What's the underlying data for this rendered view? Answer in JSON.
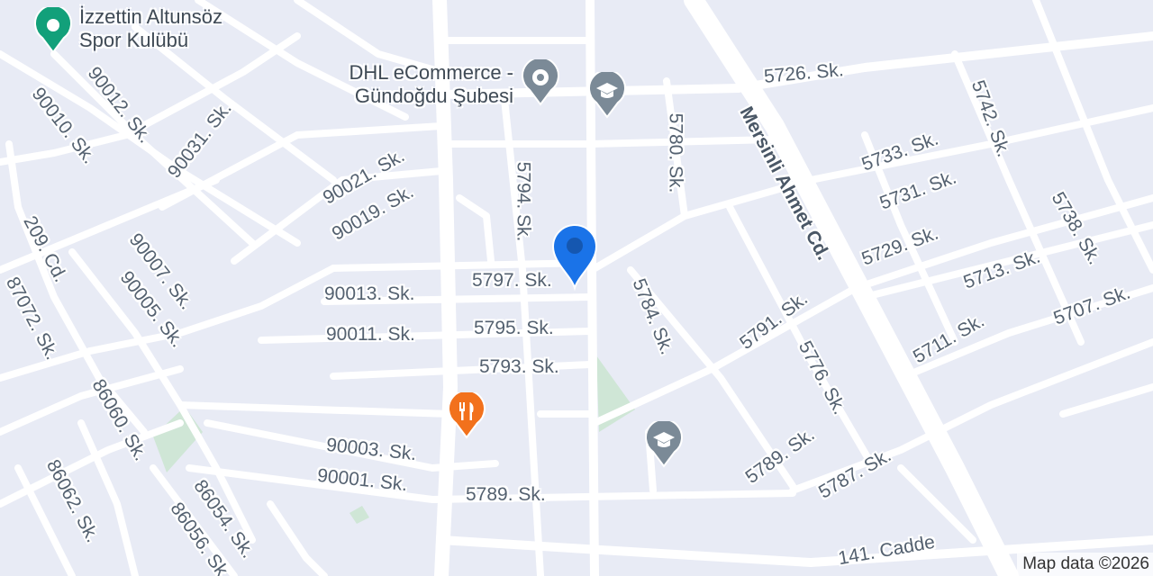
{
  "map": {
    "attribution": "Map data ©2026",
    "colors": {
      "background": "#e8ebf5",
      "road": "#ffffff",
      "park": "#cfe6d6",
      "pin": "#1a73e8",
      "poi_gray": "#7b8a97",
      "poi_orange": "#f2711c",
      "poi_green": "#12a07a"
    }
  },
  "pois": {
    "sport_club": {
      "line1": "İzzettin Altunsöz",
      "line2": "Spor Kulübü",
      "icon": "sport-place-icon"
    },
    "dhl": {
      "line1": "DHL eCommerce -",
      "line2": "Gündoğdu Şubesi",
      "icon": "place-icon"
    },
    "school_north": {
      "icon": "school-icon"
    },
    "school_south": {
      "icon": "school-icon"
    },
    "restaurant": {
      "icon": "restaurant-icon"
    },
    "location": {
      "icon": "location-pin-icon"
    }
  },
  "streets": [
    {
      "id": "s1",
      "text": "90012. Sk."
    },
    {
      "id": "s2",
      "text": "90010. Sk."
    },
    {
      "id": "s3",
      "text": "90031. Sk."
    },
    {
      "id": "s4",
      "text": "90021. Sk."
    },
    {
      "id": "s5",
      "text": "90019. Sk."
    },
    {
      "id": "s6",
      "text": "5794. Sk."
    },
    {
      "id": "s7",
      "text": "5780. Sk."
    },
    {
      "id": "s8",
      "text": "5726. Sk."
    },
    {
      "id": "s9",
      "text": "Mersinli Ahmet Cd."
    },
    {
      "id": "s10",
      "text": "5742. Sk."
    },
    {
      "id": "s11",
      "text": "5733. Sk."
    },
    {
      "id": "s12",
      "text": "5731. Sk."
    },
    {
      "id": "s13",
      "text": "5729. Sk."
    },
    {
      "id": "s14",
      "text": "5738. Sk."
    },
    {
      "id": "s15",
      "text": "5713. Sk."
    },
    {
      "id": "s16",
      "text": "5707. Sk."
    },
    {
      "id": "s17",
      "text": "5711. Sk."
    },
    {
      "id": "s18",
      "text": "209. Cd."
    },
    {
      "id": "s19",
      "text": "87072. Sk."
    },
    {
      "id": "s20",
      "text": "90007. Sk."
    },
    {
      "id": "s21",
      "text": "90005. Sk."
    },
    {
      "id": "s22",
      "text": "90013. Sk."
    },
    {
      "id": "s23",
      "text": "5797. Sk."
    },
    {
      "id": "s24",
      "text": "5784. Sk."
    },
    {
      "id": "s25",
      "text": "90011. Sk."
    },
    {
      "id": "s26",
      "text": "5795. Sk."
    },
    {
      "id": "s27",
      "text": "5791. Sk."
    },
    {
      "id": "s28",
      "text": "5776. Sk."
    },
    {
      "id": "s29",
      "text": "5793. Sk."
    },
    {
      "id": "s30",
      "text": "86060. Sk."
    },
    {
      "id": "s31",
      "text": "90003. Sk."
    },
    {
      "id": "s32",
      "text": "5789. Sk."
    },
    {
      "id": "s33",
      "text": "5787. Sk."
    },
    {
      "id": "s34",
      "text": "90001. Sk."
    },
    {
      "id": "s35",
      "text": "5789. Sk."
    },
    {
      "id": "s36",
      "text": "86062. Sk."
    },
    {
      "id": "s37",
      "text": "86054. Sk."
    },
    {
      "id": "s38",
      "text": "86056. Sk."
    },
    {
      "id": "s39",
      "text": "141. Cadde"
    }
  ]
}
